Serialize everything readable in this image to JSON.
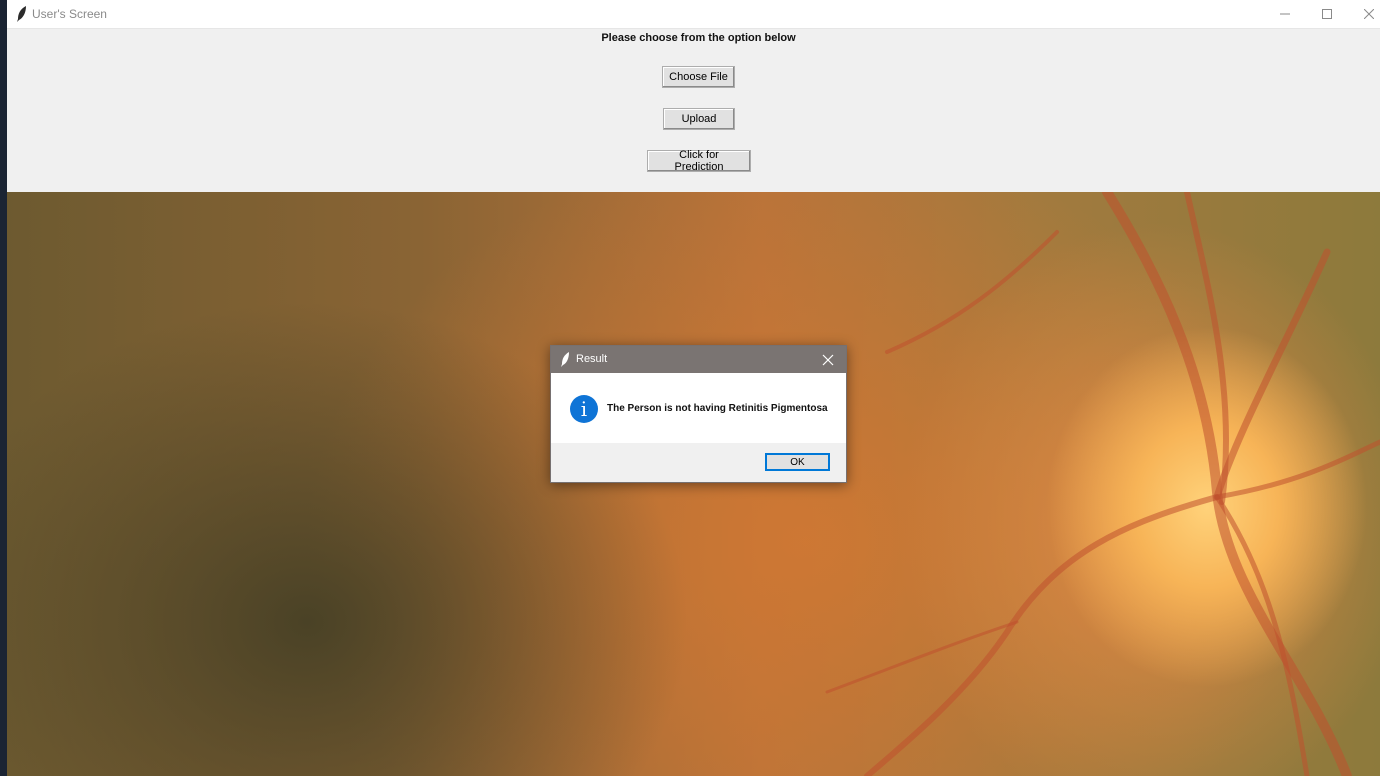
{
  "window": {
    "title": "User's Screen"
  },
  "main": {
    "instruction": "Please choose from the option below",
    "buttons": {
      "choose_file": "Choose File",
      "upload": "Upload",
      "predict": "Click for Prediction"
    }
  },
  "dialog": {
    "title": "Result",
    "message": "The Person is not having Retinitis Pigmentosa",
    "ok_label": "OK",
    "info_glyph": "i"
  },
  "icons": [
    "feather-icon",
    "minimize-icon",
    "maximize-icon",
    "close-icon",
    "info-icon"
  ],
  "colors": {
    "dialog_titlebar": "#7a7472",
    "info_blue": "#0f74d6",
    "focus_blue": "#0078d7"
  }
}
